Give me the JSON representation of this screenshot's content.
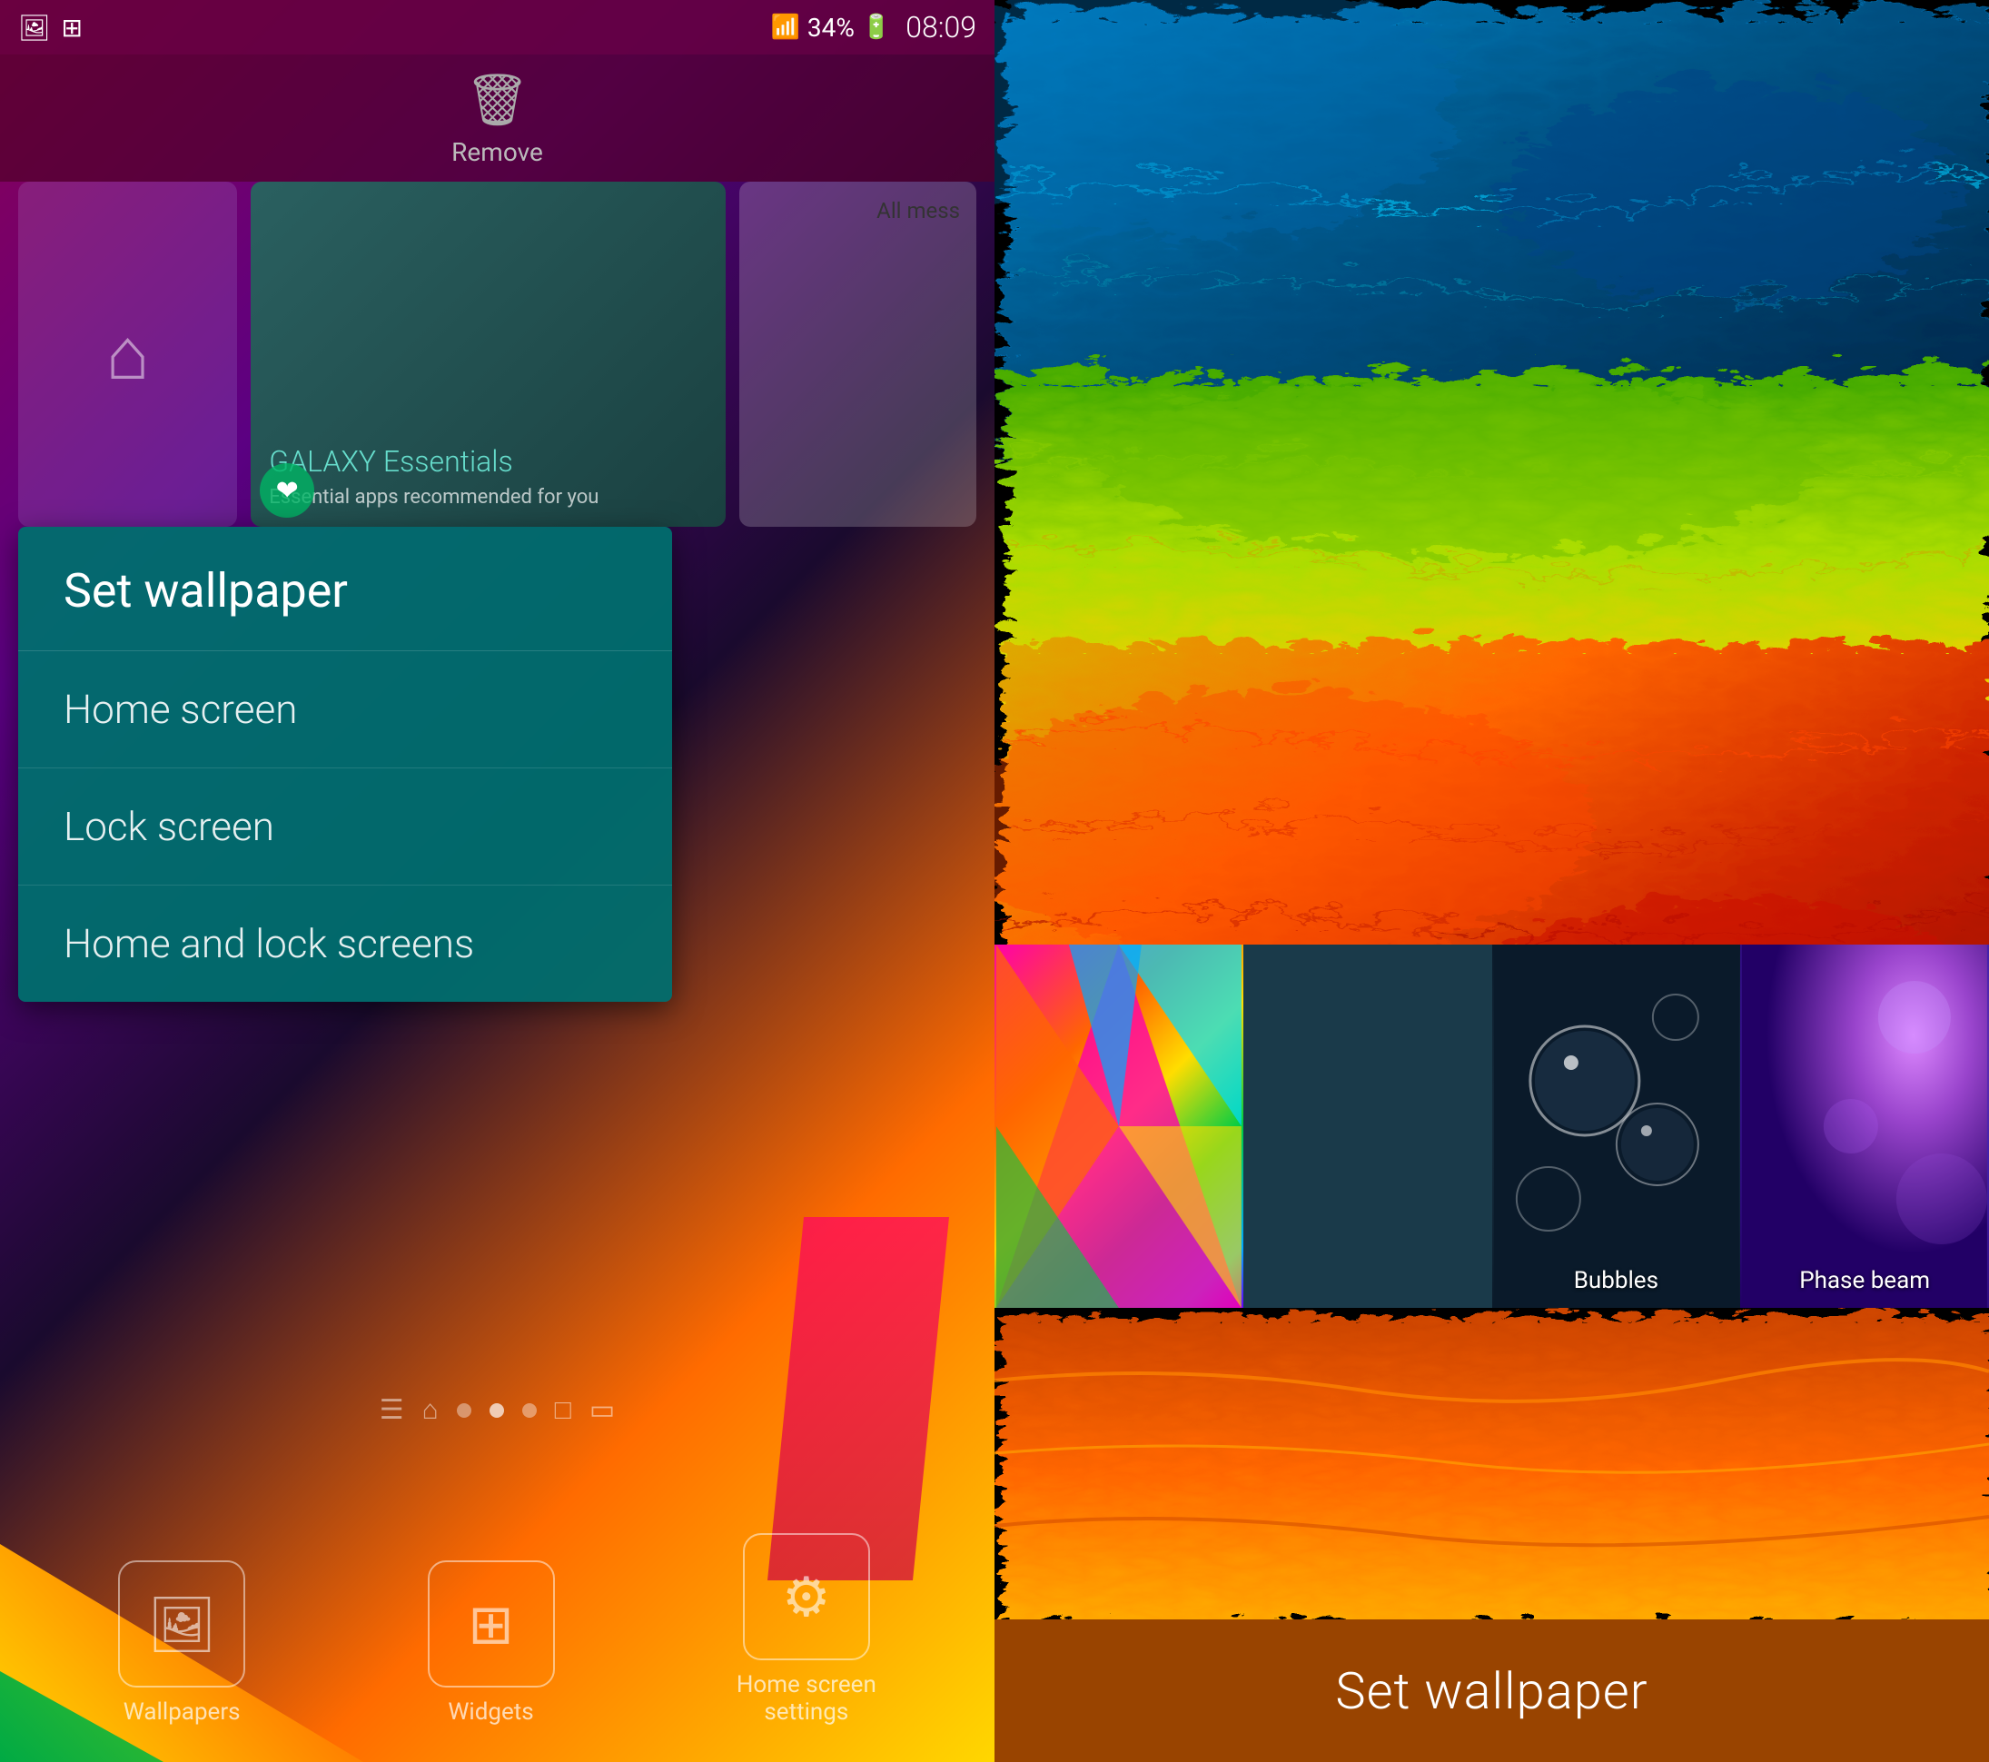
{
  "left": {
    "status": {
      "time": "08:09",
      "battery": "34%",
      "signal": "▐▐▐▌",
      "icons_left": [
        "📷",
        "🔁"
      ]
    },
    "remove_label": "Remove",
    "cards": [
      {
        "id": "home",
        "type": "home"
      },
      {
        "id": "galaxy",
        "title": "GALAXY Essentials",
        "subtitle": "Essential apps recommended for you"
      },
      {
        "id": "messages",
        "label": "All mess"
      }
    ],
    "menu": {
      "header": "Set wallpaper",
      "items": [
        {
          "label": "Home screen"
        },
        {
          "label": "Lock screen"
        },
        {
          "label": "Home and lock screens"
        }
      ]
    },
    "bottom_icons": [
      {
        "label": "Wallpapers",
        "icon": "🖼"
      },
      {
        "label": "Widgets",
        "icon": "⊞"
      },
      {
        "label": "Home screen\nsettings",
        "icon": "⚙"
      }
    ]
  },
  "right": {
    "thumbnails": [
      {
        "label": ""
      },
      {
        "label": ""
      },
      {
        "label": "Bubbles"
      },
      {
        "label": "Phase beam"
      }
    ],
    "set_wallpaper_label": "Set wallpaper"
  }
}
